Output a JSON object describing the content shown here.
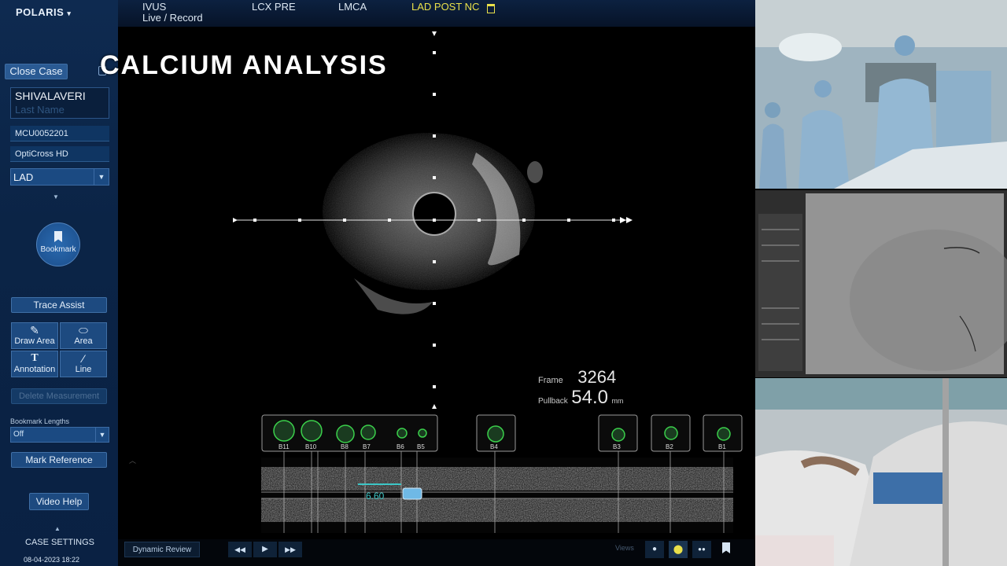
{
  "app": {
    "brand": "POLARIS",
    "brand_caret": "▾"
  },
  "tabs": [
    {
      "label_line1": "IVUS",
      "label_line2": "Live / Record"
    },
    {
      "label_line1": "LCX PRE"
    },
    {
      "label_line1": "LMCA"
    },
    {
      "label_line1": "LAD POST NC"
    }
  ],
  "overlay": {
    "title": "CALCIUM ANALYSIS"
  },
  "sidebar": {
    "close_case": "Close Case",
    "patient_first": "SHIVALAVERI",
    "patient_last_placeholder": "Last Name",
    "patient_id": "MCU0052201",
    "catheter": "OptiCross HD",
    "vessel": "LAD",
    "bookmark": "Bookmark",
    "trace_assist": "Trace Assist",
    "tools": [
      {
        "label": "Draw Area"
      },
      {
        "label": "Area"
      },
      {
        "label": "Annotation",
        "glyph": "T"
      },
      {
        "label": "Line"
      }
    ],
    "delete_measurement": "Delete Measurement",
    "bookmark_lengths_label": "Bookmark Lengths",
    "bookmark_lengths_value": "Off",
    "mark_reference": "Mark Reference",
    "video_help": "Video Help",
    "case_settings": "CASE SETTINGS",
    "datetime": "08-04-2023 18:22"
  },
  "readout": {
    "frame_label": "Frame",
    "frame_value": "3264",
    "pullback_label": "Pullback",
    "pullback_value": "54.0",
    "pullback_unit": "mm"
  },
  "bookmarks": [
    "B11",
    "B10",
    "B8",
    "B7",
    "B6",
    "B5",
    "B4",
    "B3",
    "B2",
    "B1"
  ],
  "longview": {
    "measure": "6.60"
  },
  "bottombar": {
    "dynamic_review": "Dynamic Review",
    "views_label": "Views"
  }
}
